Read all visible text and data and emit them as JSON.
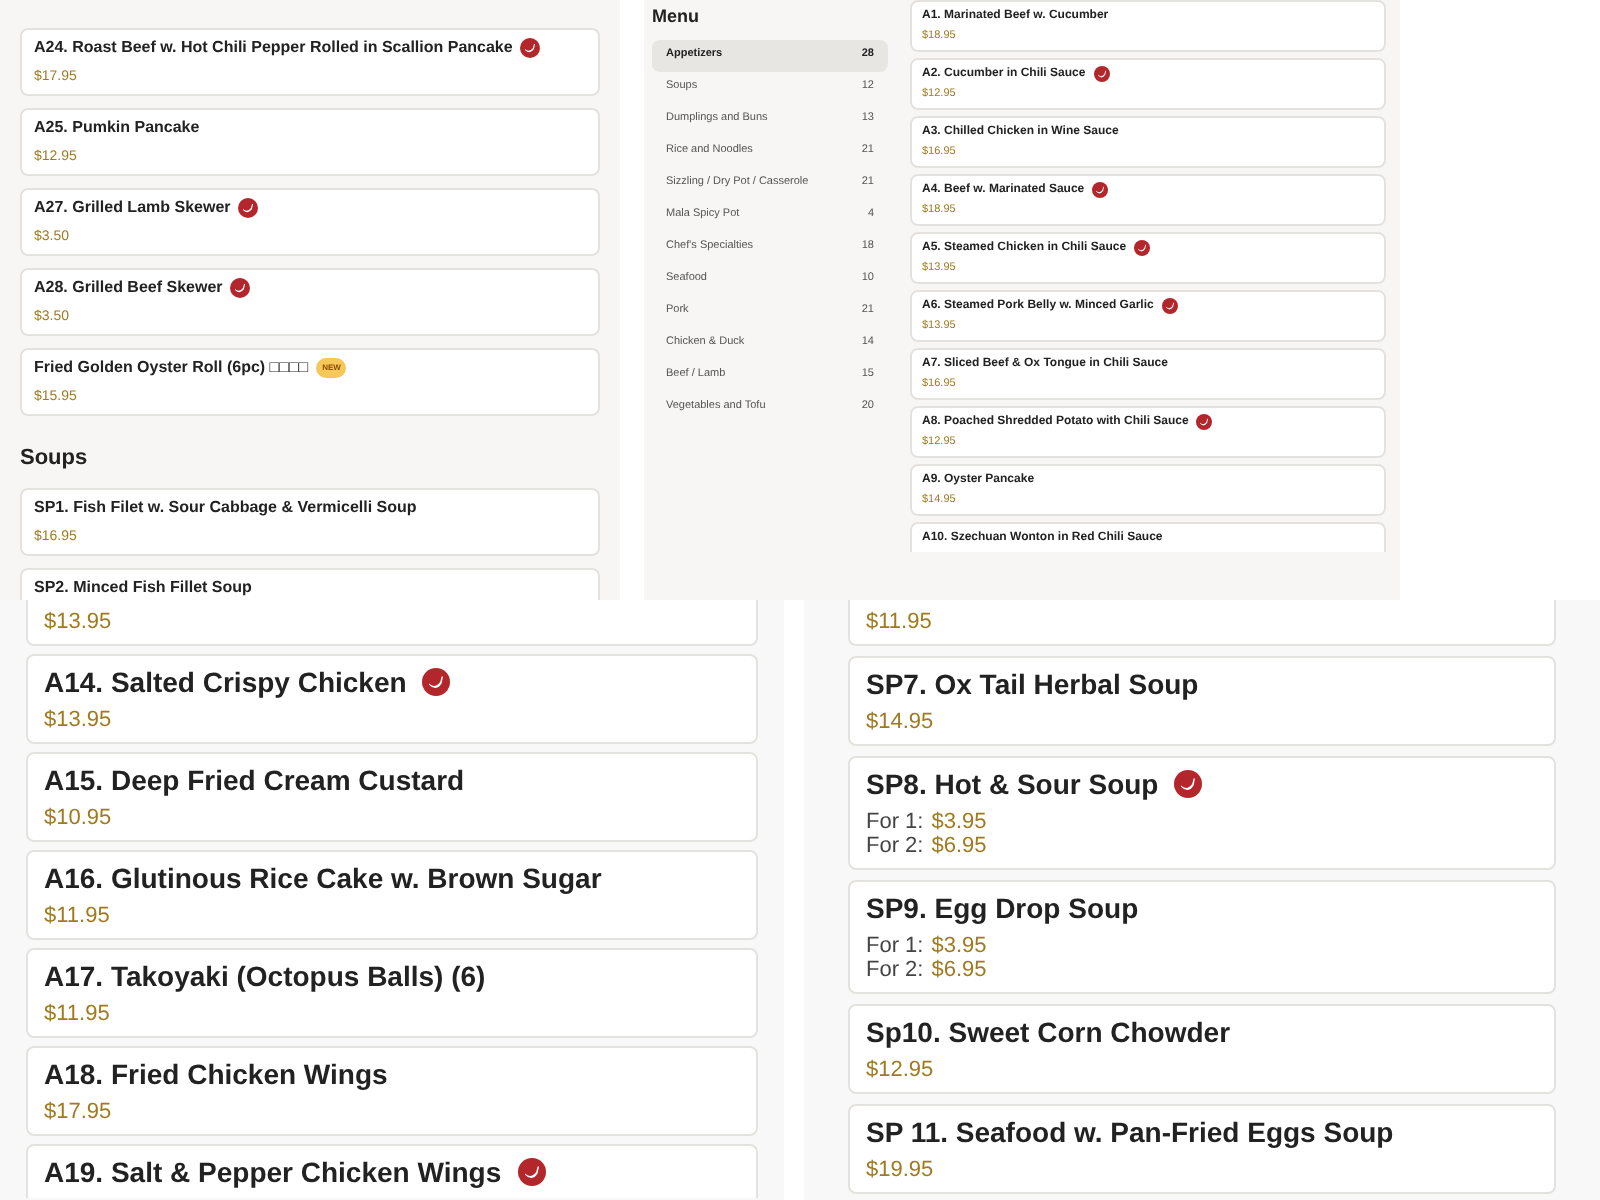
{
  "top_left": {
    "items": [
      {
        "kind": "item",
        "name": "A24. Roast Beef w. Hot Chili Pepper Rolled in Scallion Pancake",
        "spicy": true,
        "prices": [
          {
            "amount": "$17.95"
          }
        ]
      },
      {
        "kind": "item",
        "name": "A25. Pumkin Pancake",
        "spicy": false,
        "prices": [
          {
            "amount": "$12.95"
          }
        ]
      },
      {
        "kind": "item",
        "name": "A27. Grilled Lamb Skewer",
        "spicy": true,
        "prices": [
          {
            "amount": "$3.50"
          }
        ]
      },
      {
        "kind": "item",
        "name": "A28. Grilled Beef Skewer",
        "spicy": true,
        "prices": [
          {
            "amount": "$3.50"
          }
        ]
      },
      {
        "kind": "item",
        "name": "Fried Golden Oyster Roll (6pc) □□□□",
        "spicy": false,
        "badge": "NEW",
        "prices": [
          {
            "amount": "$15.95"
          }
        ]
      }
    ],
    "section": {
      "title": "Soups",
      "items": [
        {
          "kind": "item",
          "name": "SP1. Fish Filet w. Sour Cabbage & Vermicelli Soup",
          "spicy": false,
          "prices": [
            {
              "amount": "$16.95"
            }
          ]
        },
        {
          "kind": "title_only",
          "name": "SP2. Minced Fish Fillet Soup",
          "spicy": false
        }
      ]
    }
  },
  "menu": {
    "title": "Menu",
    "categories": [
      {
        "label": "Appetizers",
        "count": "28",
        "selected": true
      },
      {
        "label": "Soups",
        "count": "12",
        "selected": false
      },
      {
        "label": "Dumplings and Buns",
        "count": "13",
        "selected": false
      },
      {
        "label": "Rice and Noodles",
        "count": "21",
        "selected": false
      },
      {
        "label": "Sizzling / Dry Pot / Casserole",
        "count": "21",
        "selected": false
      },
      {
        "label": "Mala Spicy Pot",
        "count": "4",
        "selected": false
      },
      {
        "label": "Chef's Specialties",
        "count": "18",
        "selected": false
      },
      {
        "label": "Seafood",
        "count": "10",
        "selected": false
      },
      {
        "label": "Pork",
        "count": "21",
        "selected": false
      },
      {
        "label": "Chicken & Duck",
        "count": "14",
        "selected": false
      },
      {
        "label": "Beef / Lamb",
        "count": "15",
        "selected": false
      },
      {
        "label": "Vegetables and Tofu",
        "count": "20",
        "selected": false
      }
    ]
  },
  "top_right": {
    "items": [
      {
        "kind": "item",
        "name": "A1. Marinated Beef w. Cucumber",
        "spicy": false,
        "prices": [
          {
            "amount": "$18.95"
          }
        ]
      },
      {
        "kind": "item",
        "name": "A2. Cucumber in Chili Sauce",
        "spicy": true,
        "prices": [
          {
            "amount": "$12.95"
          }
        ]
      },
      {
        "kind": "item",
        "name": "A3. Chilled Chicken in Wine Sauce",
        "spicy": false,
        "prices": [
          {
            "amount": "$16.95"
          }
        ]
      },
      {
        "kind": "item",
        "name": "A4. Beef w. Marinated Sauce",
        "spicy": true,
        "prices": [
          {
            "amount": "$18.95"
          }
        ]
      },
      {
        "kind": "item",
        "name": "A5. Steamed Chicken in Chili Sauce",
        "spicy": true,
        "prices": [
          {
            "amount": "$13.95"
          }
        ]
      },
      {
        "kind": "item",
        "name": "A6. Steamed Pork Belly w. Minced Garlic",
        "spicy": true,
        "prices": [
          {
            "amount": "$13.95"
          }
        ]
      },
      {
        "kind": "item",
        "name": "A7. Sliced Beef & Ox Tongue in Chili Sauce",
        "spicy": false,
        "prices": [
          {
            "amount": "$16.95"
          }
        ]
      },
      {
        "kind": "item",
        "name": "A8. Poached Shredded Potato with Chili Sauce",
        "spicy": true,
        "prices": [
          {
            "amount": "$12.95"
          }
        ]
      },
      {
        "kind": "item",
        "name": "A9. Oyster Pancake",
        "spicy": false,
        "prices": [
          {
            "amount": "$14.95"
          }
        ]
      },
      {
        "kind": "title_only",
        "name": "A10. Szechuan Wonton in Red Chili Sauce",
        "spicy": false
      }
    ]
  },
  "bottom_left": {
    "items": [
      {
        "kind": "price_only",
        "prices": [
          {
            "amount": "$13.95"
          }
        ]
      },
      {
        "kind": "item",
        "name": "A14. Salted Crispy Chicken",
        "spicy": true,
        "prices": [
          {
            "amount": "$13.95"
          }
        ]
      },
      {
        "kind": "item",
        "name": "A15. Deep Fried Cream Custard",
        "spicy": false,
        "prices": [
          {
            "amount": "$10.95"
          }
        ]
      },
      {
        "kind": "item",
        "name": "A16. Glutinous Rice Cake w. Brown Sugar",
        "spicy": false,
        "prices": [
          {
            "amount": "$11.95"
          }
        ]
      },
      {
        "kind": "item",
        "name": "A17. Takoyaki (Octopus Balls) (6)",
        "spicy": false,
        "prices": [
          {
            "amount": "$11.95"
          }
        ]
      },
      {
        "kind": "item",
        "name": "A18. Fried Chicken Wings",
        "spicy": false,
        "prices": [
          {
            "amount": "$17.95"
          }
        ]
      },
      {
        "kind": "title_only",
        "name": "A19. Salt & Pepper Chicken Wings",
        "spicy": true
      }
    ]
  },
  "bottom_right": {
    "items": [
      {
        "kind": "price_only",
        "prices": [
          {
            "amount": "$11.95"
          }
        ]
      },
      {
        "kind": "item",
        "name": "SP7. Ox Tail Herbal Soup",
        "spicy": false,
        "prices": [
          {
            "amount": "$14.95"
          }
        ]
      },
      {
        "kind": "item",
        "name": "SP8. Hot & Sour Soup",
        "spicy": true,
        "prices": [
          {
            "label": "For 1:",
            "amount": "$3.95"
          },
          {
            "label": "For 2:",
            "amount": "$6.95"
          }
        ]
      },
      {
        "kind": "item",
        "name": "SP9. Egg Drop Soup",
        "spicy": false,
        "prices": [
          {
            "label": "For 1:",
            "amount": "$3.95"
          },
          {
            "label": "For 2:",
            "amount": "$6.95"
          }
        ]
      },
      {
        "kind": "item",
        "name": "Sp10. Sweet Corn Chowder",
        "spicy": false,
        "prices": [
          {
            "amount": "$12.95"
          }
        ]
      },
      {
        "kind": "item",
        "name": "SP 11. Seafood w. Pan-Fried Eggs Soup",
        "spicy": false,
        "prices": [
          {
            "amount": "$19.95"
          }
        ]
      }
    ]
  }
}
